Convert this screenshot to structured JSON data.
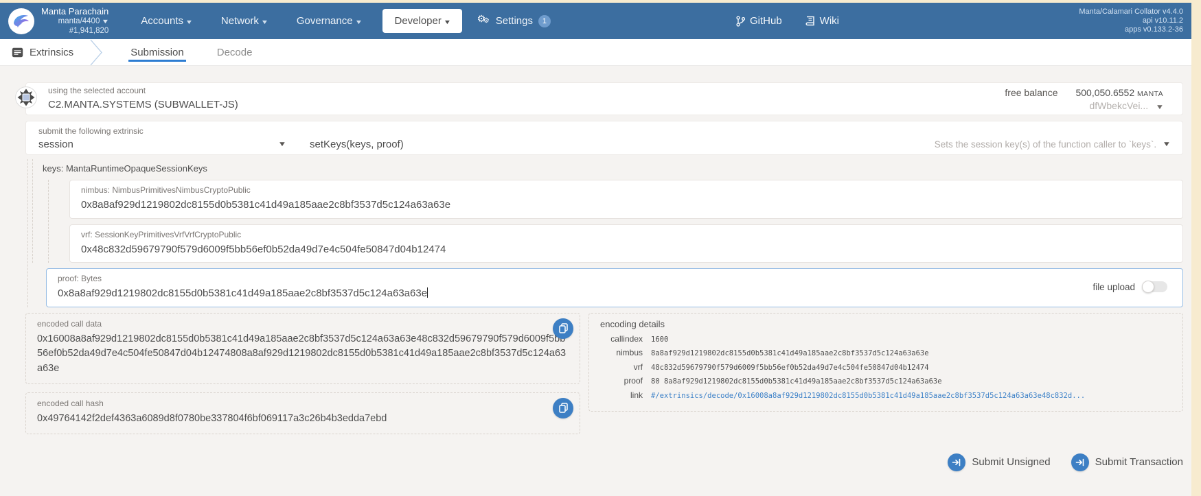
{
  "colors": {
    "navbar": "#3c6ea0",
    "accent_blue": "#3d7fc4",
    "tab_underline": "#2d7dd2",
    "link": "#3e82c8",
    "page_background": "#f5f3f1",
    "scrollbar_strip": "#f7ebcf"
  },
  "navbar": {
    "chain": {
      "name": "Manta Parachain",
      "spec": "manta/4400",
      "block": "#1,941,820"
    },
    "menus": {
      "accounts": "Accounts",
      "network": "Network",
      "governance": "Governance",
      "developer": "Developer"
    },
    "settings": {
      "label": "Settings",
      "badge": "1"
    },
    "links": {
      "github": "GitHub",
      "wiki": "Wiki"
    },
    "version": {
      "node": "Manta/Calamari Collator v4.4.0",
      "api": "api v10.11.2",
      "apps": "apps v0.133.2-36"
    }
  },
  "tabbar": {
    "app": "Extrinsics",
    "tabs": [
      {
        "label": "Submission",
        "active": true
      },
      {
        "label": "Decode",
        "active": false
      }
    ]
  },
  "account_card": {
    "label": "using the selected account",
    "account": "C2.MANTA.SYSTEMS (SUBWALLET-JS)",
    "balance_label": "free balance",
    "balance_value": "500,050.6552",
    "balance_unit": "MANTA",
    "address_short": "dfWbekcVei..."
  },
  "extrinsic_card": {
    "label": "submit the following extrinsic",
    "pallet": "session",
    "method": "setKeys(keys, proof)",
    "method_help": "Sets the session key(s) of the function caller to `keys`."
  },
  "params": {
    "keys_label": "keys: MantaRuntimeOpaqueSessionKeys",
    "nimbus": {
      "label": "nimbus: NimbusPrimitivesNimbusCryptoPublic",
      "value": "0x8a8af929d1219802dc8155d0b5381c41d49a185aae2c8bf3537d5c124a63a63e"
    },
    "vrf": {
      "label": "vrf: SessionKeyPrimitivesVrfVrfCryptoPublic",
      "value": "0x48c832d59679790f579d6009f5bb56ef0b52da49d7e4c504fe50847d04b12474"
    },
    "proof": {
      "label": "proof: Bytes",
      "value": "0x8a8af929d1219802dc8155d0b5381c41d49a185aae2c8bf3537d5c124a63a63e",
      "file_upload_label": "file upload",
      "file_upload_enabled": false
    }
  },
  "outputs": {
    "call_data": {
      "label": "encoded call data",
      "value": "0x16008a8af929d1219802dc8155d0b5381c41d49a185aae2c8bf3537d5c124a63a63e48c832d59679790f579d6009f5bb56ef0b52da49d7e4c504fe50847d04b12474808a8af929d1219802dc8155d0b5381c41d49a185aae2c8bf3537d5c124a63a63e"
    },
    "call_hash": {
      "label": "encoded call hash",
      "value": "0x49764142f2def4363a6089d8f0780be337804f6bf069117a3c26b4b3edda7ebd"
    }
  },
  "encoding_details": {
    "title": "encoding details",
    "rows": [
      {
        "label": "callindex",
        "value": "1600"
      },
      {
        "label": "nimbus",
        "value": "8a8af929d1219802dc8155d0b5381c41d49a185aae2c8bf3537d5c124a63a63e"
      },
      {
        "label": "vrf",
        "value": "48c832d59679790f579d6009f5bb56ef0b52da49d7e4c504fe50847d04b12474"
      },
      {
        "label": "proof",
        "value": "80 8a8af929d1219802dc8155d0b5381c41d49a185aae2c8bf3537d5c124a63a63e"
      },
      {
        "label": "link",
        "value": "#/extrinsics/decode/0x16008a8af929d1219802dc8155d0b5381c41d49a185aae2c8bf3537d5c124a63a63e48c832d..."
      }
    ]
  },
  "actions": {
    "submit_unsigned": "Submit Unsigned",
    "submit_transaction": "Submit Transaction"
  }
}
